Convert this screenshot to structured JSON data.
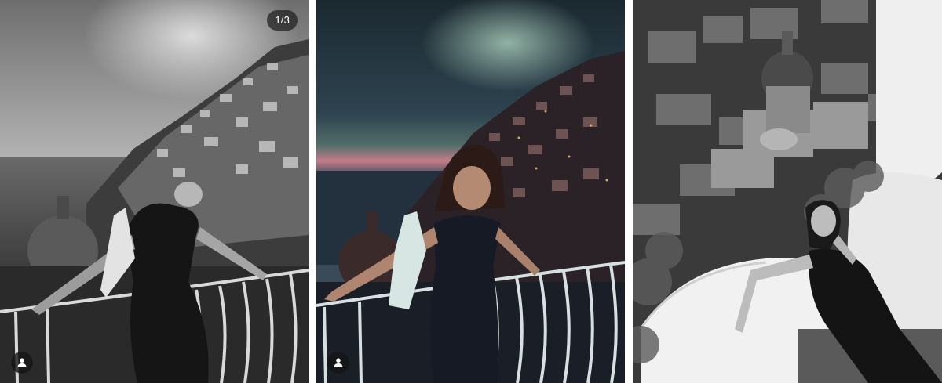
{
  "carousel": {
    "counter": "1/3",
    "slides": [
      {
        "id": "slide-1",
        "tone": "monochrome"
      },
      {
        "id": "slide-2",
        "tone": "color-dusk"
      },
      {
        "id": "slide-3",
        "tone": "monochrome"
      }
    ],
    "tag_icon": "person-icon"
  },
  "colors": {
    "badge_bg": "#1e1e1e",
    "badge_text": "#ffffff",
    "dusk_sky_top": "#1f2e36",
    "dusk_glow": "#8fb4a8",
    "dusk_horizon": "#c47d8a",
    "mono_sky": "#9a9a9a"
  }
}
